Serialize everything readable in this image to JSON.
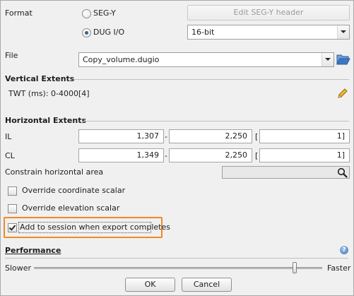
{
  "format": {
    "label": "Format",
    "segy_label": "SEG-Y",
    "dug_label": "DUG I/O",
    "edit_segy_header_label": "Edit SEG-Y header",
    "bit_depth": "16-bit"
  },
  "file": {
    "label": "File",
    "value": "Copy_volume.dugio"
  },
  "vertical_extents": {
    "title": "Vertical Extents",
    "twt_text": "TWT (ms): 0-4000[4]"
  },
  "horizontal_extents": {
    "title": "Horizontal Extents",
    "il": {
      "label": "IL",
      "from": "1,307",
      "dash": "-",
      "to": "2,250",
      "bracket": "[",
      "step": "1]"
    },
    "cl": {
      "label": "CL",
      "from": "1,349",
      "dash": "-",
      "to": "2,250",
      "bracket": "[",
      "step": "1]"
    },
    "constrain_label": "Constrain horizontal area"
  },
  "options": {
    "override_coord_label": "Override coordinate scalar",
    "override_elev_label": "Override elevation scalar",
    "add_to_session_label": "Add to session when export completes"
  },
  "performance": {
    "title": "Performance",
    "slower_label": "Slower",
    "faster_label": "Faster",
    "level": 0.91
  },
  "buttons": {
    "ok_label": "OK",
    "cancel_label": "Cancel"
  },
  "colors": {
    "highlight": "#f08a24",
    "folder_icon": "#3b78c4",
    "pencil_icon": "#e3a21a"
  }
}
